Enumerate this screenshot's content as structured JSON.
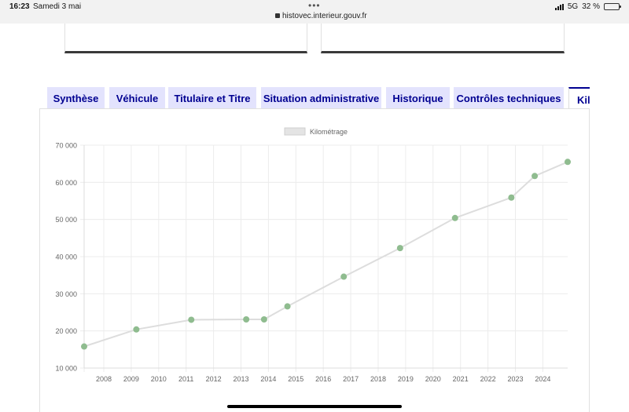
{
  "status_bar": {
    "time": "16:23",
    "date": "Samedi 3 mai",
    "url": "histovec.interieur.gouv.fr",
    "network": "5G",
    "battery": "32 %",
    "battery_level": 0.32
  },
  "tabs": [
    {
      "label": "Synthèse",
      "active": false
    },
    {
      "label": "Véhicule",
      "active": false
    },
    {
      "label": "Titulaire et Titre",
      "active": false
    },
    {
      "label": "Situation administrative",
      "active": false
    },
    {
      "label": "Historique",
      "active": false
    },
    {
      "label": "Contrôles techniques",
      "active": false
    },
    {
      "label": "Kilo",
      "active": true
    }
  ],
  "colors": {
    "tab_bg": "#e3e3fd",
    "tab_text": "#000091",
    "line": "#dddddd",
    "point": "#8fbc8f"
  },
  "chart_data": {
    "type": "line",
    "legend": [
      "Kilométrage"
    ],
    "legend_position": "top-center",
    "series": [
      {
        "name": "Kilométrage",
        "points": [
          {
            "x": 2007.3,
            "y": 15800
          },
          {
            "x": 2009.2,
            "y": 20400
          },
          {
            "x": 2011.2,
            "y": 23000
          },
          {
            "x": 2013.2,
            "y": 23100
          },
          {
            "x": 2013.85,
            "y": 23100
          },
          {
            "x": 2014.7,
            "y": 26600
          },
          {
            "x": 2016.75,
            "y": 34600
          },
          {
            "x": 2018.8,
            "y": 42300
          },
          {
            "x": 2020.8,
            "y": 50400
          },
          {
            "x": 2022.85,
            "y": 55900
          },
          {
            "x": 2023.7,
            "y": 61700
          },
          {
            "x": 2024.9,
            "y": 65500
          }
        ]
      }
    ],
    "x_ticks": [
      "2008",
      "2009",
      "2010",
      "2011",
      "2012",
      "2013",
      "2014",
      "2015",
      "2016",
      "2017",
      "2018",
      "2019",
      "2020",
      "2021",
      "2022",
      "2023",
      "2024"
    ],
    "y_ticks": [
      "10 000",
      "20 000",
      "30 000",
      "40 000",
      "50 000",
      "60 000",
      "70 000"
    ],
    "xlim": [
      2007.3,
      2024.9
    ],
    "ylim": [
      10000,
      70000
    ],
    "grid": true
  }
}
